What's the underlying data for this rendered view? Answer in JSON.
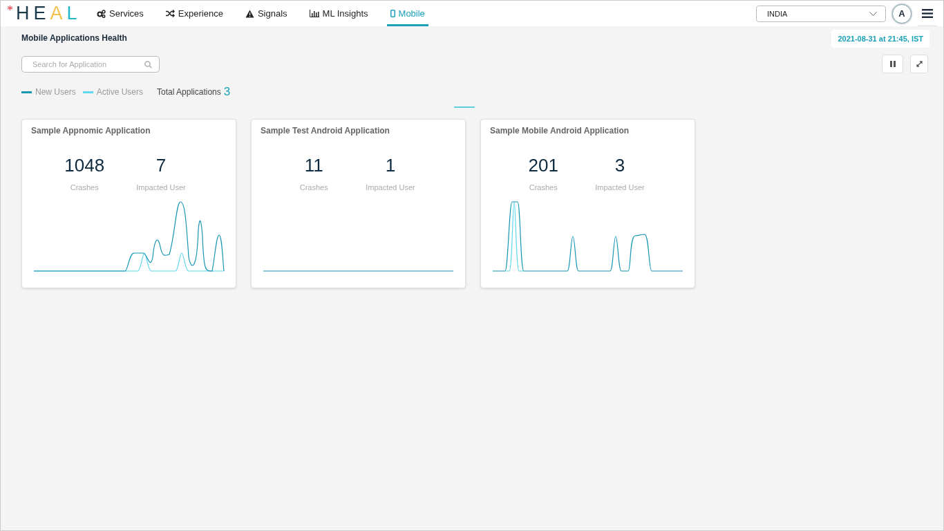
{
  "logo": {
    "text": "HEAL"
  },
  "nav": [
    {
      "label": "Services",
      "kind": "gears",
      "selected": false
    },
    {
      "label": "Experience",
      "kind": "shuffle",
      "selected": false
    },
    {
      "label": "Signals",
      "kind": "warning",
      "selected": false
    },
    {
      "label": "ML Insights",
      "kind": "bars",
      "selected": false
    },
    {
      "label": "Mobile",
      "kind": "phone",
      "selected": true
    }
  ],
  "account": {
    "value": "INDIA"
  },
  "avatar": {
    "initial": "A"
  },
  "page_title": "Mobile Applications Health",
  "timestamp": "2021-08-31 at 21:45, IST",
  "search": {
    "placeholder": "Search for Application"
  },
  "legend": [
    {
      "label": "New Users",
      "color": "#1596b3"
    },
    {
      "label": "Active Users",
      "color": "#5fd8f0"
    }
  ],
  "total": {
    "label": "Total Applications",
    "value": "3"
  },
  "cards": [
    {
      "title": "Sample Appnomic Application",
      "crashes": "1048",
      "crashes_label": "Crashes",
      "impacted": "7",
      "impacted_label": "Impacted User"
    },
    {
      "title": "Sample Test Android Application",
      "crashes": "11",
      "crashes_label": "Crashes",
      "impacted": "1",
      "impacted_label": "Impacted User"
    },
    {
      "title": "Sample Mobile Android Application",
      "crashes": "201",
      "crashes_label": "Crashes",
      "impacted": "3",
      "impacted_label": "Impacted User"
    }
  ]
}
